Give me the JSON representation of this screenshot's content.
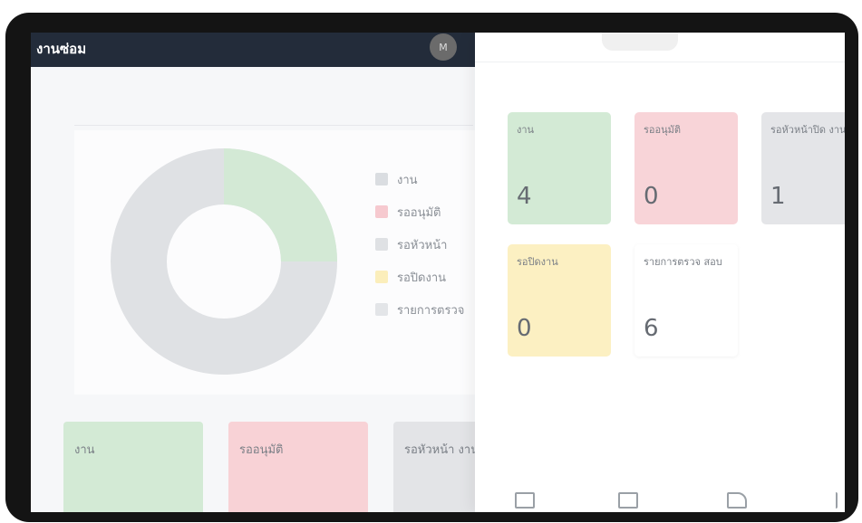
{
  "header": {
    "title": "งานซ่อม",
    "avatar_initial": "M"
  },
  "legend": [
    {
      "label": "งาน",
      "color": "#dadde1"
    },
    {
      "label": "รออนุมัติ",
      "color": "#f6c9cf"
    },
    {
      "label": "รอหัวหน้า",
      "color": "#dfe1e4"
    },
    {
      "label": "รอปิดงาน",
      "color": "#fbeebb"
    },
    {
      "label": "รายการตรวจ",
      "color": "#e3e5e8"
    }
  ],
  "donut": {
    "fill_color": "#dfe1e4",
    "highlight_color": "#cde8cf"
  },
  "back_cards": [
    {
      "label": "งาน",
      "color": "#d3ead5"
    },
    {
      "label": "รออนุมัติ",
      "color": "#f8d2d6"
    },
    {
      "label": "รอหัวหน้า งาน",
      "color": "#e3e4e7"
    }
  ],
  "phone_cards": [
    {
      "label": "งาน",
      "value": "4",
      "color": "#d3ead5"
    },
    {
      "label": "รออนุมัติ",
      "value": "0",
      "color": "#f8d4d8"
    },
    {
      "label": "รอหัวหน้าปิด งาน",
      "value": "1",
      "color": "#e4e5e8"
    },
    {
      "label": "รอปิดงาน",
      "value": "0",
      "color": "#fcf0c2"
    },
    {
      "label": "รายการตรวจ สอบ",
      "value": "6",
      "color": "#ffffff"
    }
  ],
  "bottom_nav": [
    "calendar-icon",
    "list-icon",
    "pen-icon",
    "more-icon"
  ]
}
